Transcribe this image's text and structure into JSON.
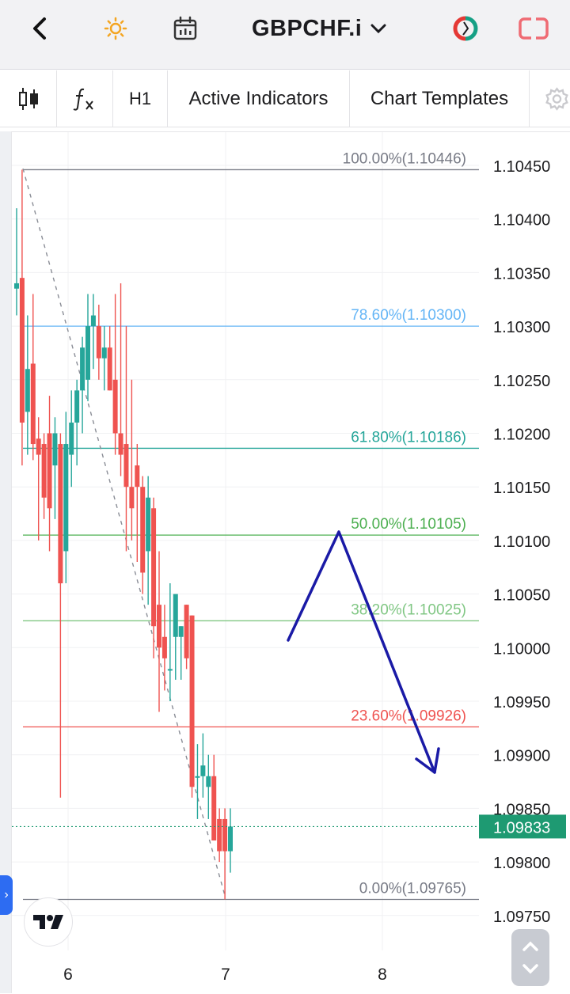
{
  "header": {
    "symbol": "GBPCHF.i",
    "back_icon": "chevron-left-icon",
    "theme_icon": "sun-icon",
    "calendar_icon": "calendar-icon",
    "dropdown_icon": "chevron-down-icon",
    "sentiment_icon": "sentiment-ring-icon",
    "layout_icon": "layout-icon"
  },
  "toolbar": {
    "chart_type_icon": "candlestick-icon",
    "indicator_icon": "fx-icon",
    "timeframe": "H1",
    "active_indicators": "Active Indicators",
    "chart_templates": "Chart Templates",
    "settings_icon": "gear-icon"
  },
  "colors": {
    "up": "#26a69a",
    "down": "#ef5350",
    "last_price_bg": "#1e9a72",
    "arrow": "#1a1aa6",
    "fib_100": "#787b86",
    "fib_786": "#64b5f6",
    "fib_618": "#26a69a",
    "fib_50": "#4caf50",
    "fib_382": "#81c784",
    "fib_236": "#ef5350",
    "fib_0": "#787b86"
  },
  "chart_data": {
    "type": "candlestick",
    "symbol": "GBPCHF.i",
    "timeframe": "H1",
    "x_ticks": [
      "6",
      "7",
      "8"
    ],
    "y_ticks": [
      "1.10450",
      "1.10400",
      "1.10350",
      "1.10300",
      "1.10250",
      "1.10200",
      "1.10150",
      "1.10100",
      "1.10050",
      "1.10000",
      "1.09950",
      "1.09900",
      "1.09850",
      "1.09800",
      "1.09750"
    ],
    "ylim": [
      1.0971,
      1.1049
    ],
    "last_price": "1.09833",
    "last_price_value": 1.09833,
    "fib_levels": [
      {
        "label": "100.00%(1.10446)",
        "price": 1.10446
      },
      {
        "label": "78.60%(1.10300)",
        "price": 1.103
      },
      {
        "label": "61.80%(1.10186)",
        "price": 1.10186
      },
      {
        "label": "50.00%(1.10105)",
        "price": 1.10105
      },
      {
        "label": "38.20%(1.10025)",
        "price": 1.10025
      },
      {
        "label": "23.60%(1.09926)",
        "price": 1.09926
      },
      {
        "label": "0.00%(1.09765)",
        "price": 1.09765
      }
    ],
    "candles": [
      {
        "o": 1.10335,
        "h": 1.1041,
        "l": 1.1031,
        "c": 1.1034
      },
      {
        "o": 1.10345,
        "h": 1.10446,
        "l": 1.1017,
        "c": 1.1021
      },
      {
        "o": 1.1022,
        "h": 1.1031,
        "l": 1.1018,
        "c": 1.1026
      },
      {
        "o": 1.10265,
        "h": 1.1033,
        "l": 1.10175,
        "c": 1.1019
      },
      {
        "o": 1.10195,
        "h": 1.10215,
        "l": 1.101,
        "c": 1.1018
      },
      {
        "o": 1.1019,
        "h": 1.102,
        "l": 1.1012,
        "c": 1.1014
      },
      {
        "o": 1.102,
        "h": 1.10235,
        "l": 1.1009,
        "c": 1.1013
      },
      {
        "o": 1.1017,
        "h": 1.10215,
        "l": 1.1012,
        "c": 1.102
      },
      {
        "o": 1.1019,
        "h": 1.102,
        "l": 1.0986,
        "c": 1.1006
      },
      {
        "o": 1.1009,
        "h": 1.1022,
        "l": 1.1006,
        "c": 1.1019
      },
      {
        "o": 1.1018,
        "h": 1.1024,
        "l": 1.1015,
        "c": 1.1021
      },
      {
        "o": 1.1021,
        "h": 1.1025,
        "l": 1.1017,
        "c": 1.1024
      },
      {
        "o": 1.1024,
        "h": 1.1029,
        "l": 1.102,
        "c": 1.1028
      },
      {
        "o": 1.1025,
        "h": 1.1033,
        "l": 1.1023,
        "c": 1.103
      },
      {
        "o": 1.103,
        "h": 1.1033,
        "l": 1.1026,
        "c": 1.1031
      },
      {
        "o": 1.103,
        "h": 1.1032,
        "l": 1.1025,
        "c": 1.1027
      },
      {
        "o": 1.1027,
        "h": 1.103,
        "l": 1.1024,
        "c": 1.1028
      },
      {
        "o": 1.1028,
        "h": 1.103,
        "l": 1.1024,
        "c": 1.1024
      },
      {
        "o": 1.1025,
        "h": 1.1033,
        "l": 1.1018,
        "c": 1.102
      },
      {
        "o": 1.102,
        "h": 1.1034,
        "l": 1.1016,
        "c": 1.1018
      },
      {
        "o": 1.1019,
        "h": 1.103,
        "l": 1.1009,
        "c": 1.1015
      },
      {
        "o": 1.1015,
        "h": 1.1025,
        "l": 1.101,
        "c": 1.1013
      },
      {
        "o": 1.1017,
        "h": 1.1019,
        "l": 1.1008,
        "c": 1.1015
      },
      {
        "o": 1.1015,
        "h": 1.1016,
        "l": 1.1005,
        "c": 1.1007
      },
      {
        "o": 1.1009,
        "h": 1.1016,
        "l": 1.1004,
        "c": 1.1014
      },
      {
        "o": 1.1013,
        "h": 1.1014,
        "l": 1.0999,
        "c": 1.1002
      },
      {
        "o": 1.1004,
        "h": 1.1009,
        "l": 1.0994,
        "c": 1.1
      },
      {
        "o": 1.1001,
        "h": 1.1004,
        "l": 1.0996,
        "c": 1.0999
      },
      {
        "o": 1.0998,
        "h": 1.1006,
        "l": 1.0995,
        "c": 1.0998
      },
      {
        "o": 1.1001,
        "h": 1.1002,
        "l": 1.0997,
        "c": 1.1005
      },
      {
        "o": 1.1001,
        "h": 1.1002,
        "l": 1.0997,
        "c": 1.1002
      },
      {
        "o": 1.1004,
        "h": 1.1004,
        "l": 1.0998,
        "c": 1.0999
      },
      {
        "o": 1.1003,
        "h": 1.1003,
        "l": 1.0986,
        "c": 1.0987
      },
      {
        "o": 1.0988,
        "h": 1.0991,
        "l": 1.0984,
        "c": 1.0988
      },
      {
        "o": 1.0988,
        "h": 1.0992,
        "l": 1.0986,
        "c": 1.0989
      },
      {
        "o": 1.0987,
        "h": 1.099,
        "l": 1.0984,
        "c": 1.0988
      },
      {
        "o": 1.0988,
        "h": 1.099,
        "l": 1.0982,
        "c": 1.0982
      },
      {
        "o": 1.0984,
        "h": 1.0985,
        "l": 1.098,
        "c": 1.0981
      },
      {
        "o": 1.0984,
        "h": 1.0985,
        "l": 1.09765,
        "c": 1.0981
      },
      {
        "o": 1.0981,
        "h": 1.0985,
        "l": 1.0979,
        "c": 1.09833
      }
    ]
  }
}
